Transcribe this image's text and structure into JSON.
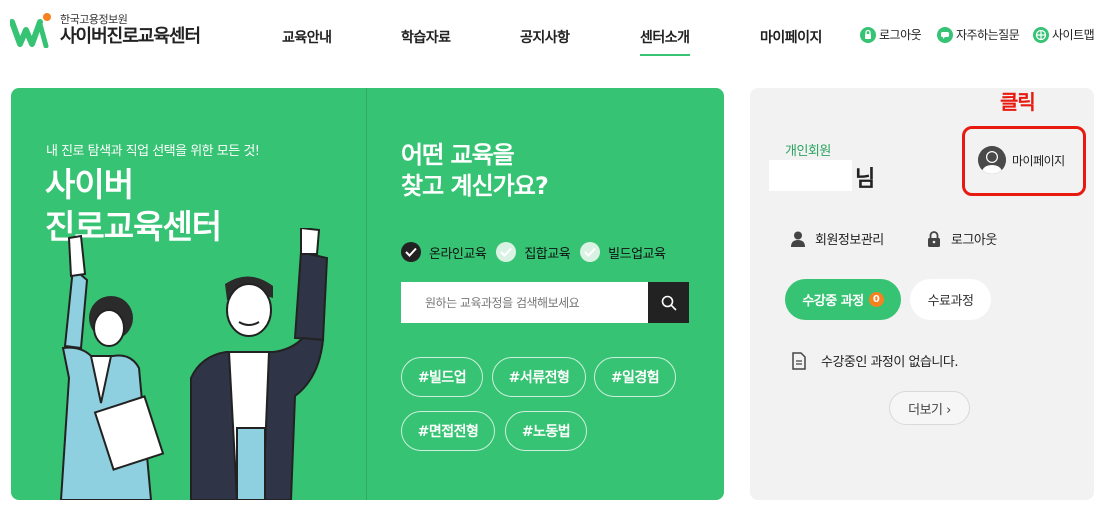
{
  "header": {
    "logo_sub": "한국고용정보원",
    "logo_main": "사이버진로교육센터",
    "nav": [
      "교육안내",
      "학습자료",
      "공지사항",
      "센터소개",
      "마이페이지"
    ],
    "active_nav": "센터소개",
    "utils": [
      {
        "label": "로그아웃",
        "icon": "lock-icon"
      },
      {
        "label": "자주하는질문",
        "icon": "chat-icon"
      },
      {
        "label": "사이트맵",
        "icon": "sitemap-icon"
      }
    ]
  },
  "hero": {
    "subtitle": "내 진로 탐색과 직업 선택을 위한 모든 것!",
    "title_line1": "사이버",
    "title_line2": "진로교육센터",
    "question_line1": "어떤 교육을",
    "question_line2": "찾고 계신가요?",
    "checks": [
      {
        "label": "온라인교육",
        "checked": true
      },
      {
        "label": "집합교육",
        "checked": false
      },
      {
        "label": "빌드업교육",
        "checked": false
      }
    ],
    "search_placeholder": "원하는 교육과정을 검색해보세요",
    "tags": [
      "#빌드업",
      "#서류전형",
      "#일경험",
      "#면접전형",
      "#노동법"
    ]
  },
  "panel": {
    "annotation": "클릭",
    "member_type": "개인회원",
    "name_suffix": "님",
    "mypage_label": "마이페이지",
    "member_info_label": "회원정보관리",
    "logout_label": "로그아웃",
    "in_progress_label": "수강중 과정",
    "in_progress_count": "0",
    "completed_label": "수료과정",
    "empty_message": "수강중인 과정이 없습니다.",
    "more_label": "더보기 ›"
  },
  "colors": {
    "brand_green": "#36c373",
    "annotation_red": "#e8190f",
    "badge_orange": "#f5821f"
  }
}
